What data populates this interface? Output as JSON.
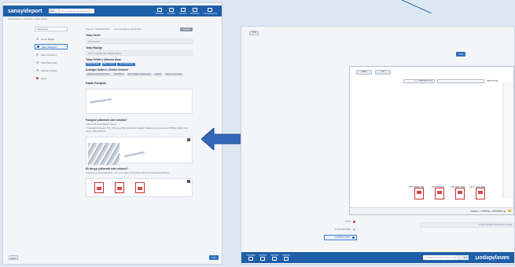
{
  "logo": "sanayideport",
  "search": {
    "category": "Ürün",
    "placeholder": "ürün, firma ya da hizmet ara..."
  },
  "nav": [
    "Mesajlar",
    "Favoriler",
    "Sepetim",
    "Bildirimler",
    "Sanayideport'a"
  ],
  "breadcrumb": "Sanayideport / Hesabım / Satış Talebi",
  "sidebar": {
    "selector": "Kategoriler",
    "items": [
      "Genel Bilgiler",
      "Satış Talepleri",
      "Satın Alımlarım",
      "Teklif Geçmişim",
      "Hizmet Fiyatları",
      "Çıkış"
    ]
  },
  "form": {
    "header_info": "Satış No: TR20250409001",
    "header_date": "Son Güncelleme: 09.04.2025",
    "header_button": "Yayınla",
    "fields": [
      {
        "label": "Talep Tarihi",
        "value": "07.04.2025"
      },
      {
        "label": "Talep Başlığı",
        "value": "316 Ti Paslanmaz Dikişsiz Boru"
      }
    ],
    "sector_label": "Talep Sektör | Çalışma Alanı",
    "sector_tags": [
      "Metal Sanayi",
      "Boru Üretimi",
      "Yapı Malzemesi"
    ],
    "product_label": "Aradığın Kalitesi | Sektör Ürünleri",
    "product_tags": [
      "Paslanmaz Dikişsiz Boru",
      "Profil Boru",
      "Boru Bağlantı Elemanları",
      "Fittings",
      "Flanş ve Contalar"
    ],
    "photo_label": "Kapak Fotoğrafı",
    "gallery_label": "Fotoğraf yüklemek ister misiniz?",
    "gallery_hint": "Ürünlerinize ait fotoğrafları ekleyin.",
    "gallery_desc": "* Yüklediğiniz dosyalar JPG, PNG veya PDF formatında olmalıdır. Maksimum dosya boyutu 5 MB'dır. Birden fazla dosya yükleyebilirsiniz.",
    "docs_label": "Ek dosya yüklemek ister misiniz?",
    "docs_desc": "Talebinize ait teknik şartname, çizim ya da diğer dokümanları PDF formatında ekleyebilirsiniz.",
    "pdfs": [
      "dokuman-1.pdf",
      "dokuman-2.pdf",
      "dokuman-3.pdf"
    ],
    "back_button": "Geri",
    "next_button": "İleri"
  },
  "dialog": {
    "title": "Dosya Aç",
    "path": "Bu bilgisayar > Belgeler > Teklifler",
    "filename_label": "Dosya adı:",
    "filetype": "Tüm dosyalar (*.*)",
    "open": "Aç",
    "cancel": "İptal",
    "files": [
      "teklif_form_1.pdf",
      "boru_cizim.pdf",
      "sartname.pdf",
      "olcu_tablosu.pdf"
    ]
  },
  "colors": {
    "brand": "#1f5fa8",
    "accent": "#2e6fc0",
    "pdf": "#d64545"
  }
}
